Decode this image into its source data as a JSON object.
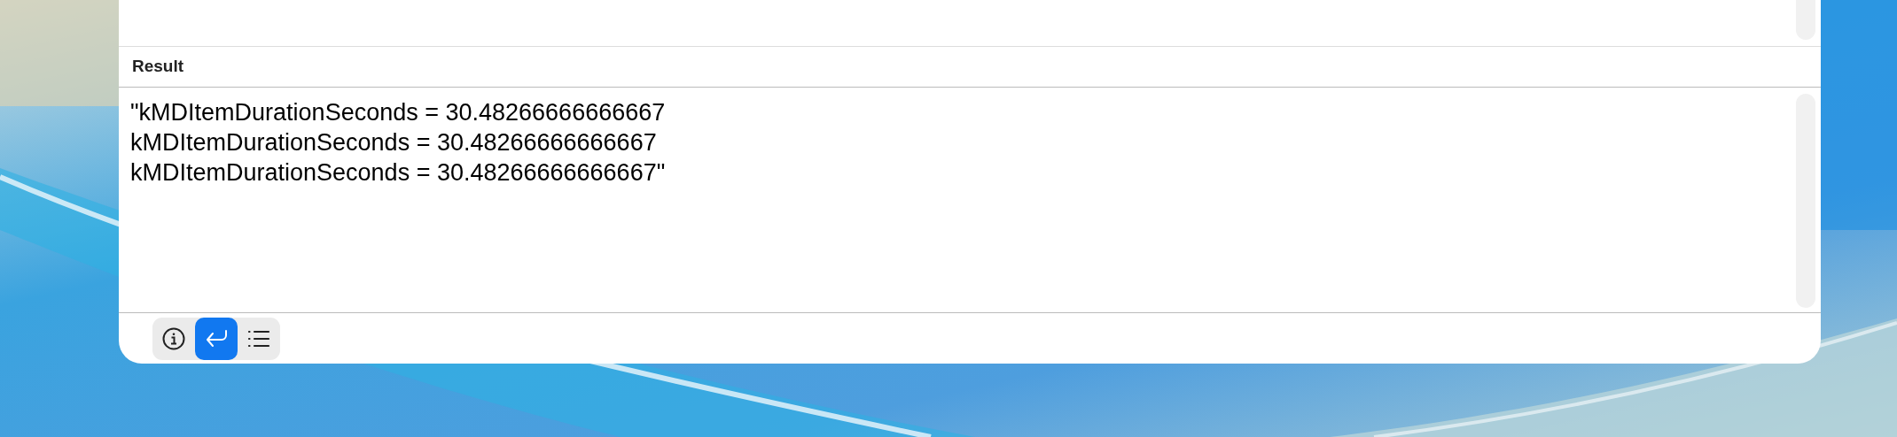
{
  "result": {
    "header": "Result",
    "text": "\"kMDItemDurationSeconds = 30.48266666666667\nkMDItemDurationSeconds = 30.48266666666667\nkMDItemDurationSeconds = 30.48266666666667\""
  },
  "toolbar": [
    {
      "kind": "info",
      "selected": false
    },
    {
      "kind": "return",
      "selected": true
    },
    {
      "kind": "list",
      "selected": false
    }
  ]
}
